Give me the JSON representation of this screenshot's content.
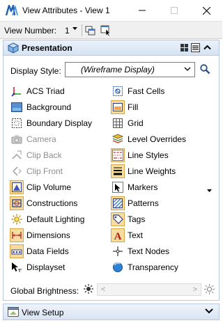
{
  "window": {
    "title": "View Attributes - View 1"
  },
  "toolbar": {
    "view_number_label": "View Number:",
    "view_number_value": "1"
  },
  "panel": {
    "title": "Presentation",
    "display_style_label": "Display Style:",
    "display_style_value": "(Wireframe Display)"
  },
  "attributes": [
    {
      "label": "ACS Triad",
      "icon": "acs-triad-icon",
      "enabled": true,
      "selected": false
    },
    {
      "label": "Background",
      "icon": "background-icon",
      "enabled": true,
      "selected": false
    },
    {
      "label": "Boundary Display",
      "icon": "boundary-display-icon",
      "enabled": true,
      "selected": false
    },
    {
      "label": "Camera",
      "icon": "camera-icon",
      "enabled": false,
      "selected": false
    },
    {
      "label": "Clip Back",
      "icon": "clip-back-icon",
      "enabled": false,
      "selected": false
    },
    {
      "label": "Clip Front",
      "icon": "clip-front-icon",
      "enabled": false,
      "selected": false
    },
    {
      "label": "Clip Volume",
      "icon": "clip-volume-icon",
      "enabled": true,
      "selected": true
    },
    {
      "label": "Constructions",
      "icon": "constructions-icon",
      "enabled": true,
      "selected": true
    },
    {
      "label": "Default Lighting",
      "icon": "default-lighting-icon",
      "enabled": true,
      "selected": false
    },
    {
      "label": "Dimensions",
      "icon": "dimensions-icon",
      "enabled": true,
      "selected": true
    },
    {
      "label": "Data Fields",
      "icon": "data-fields-icon",
      "enabled": true,
      "selected": true
    },
    {
      "label": "Displayset",
      "icon": "displayset-icon",
      "enabled": true,
      "selected": false
    },
    {
      "label": "Fast Cells",
      "icon": "fast-cells-icon",
      "enabled": true,
      "selected": false
    },
    {
      "label": "Fill",
      "icon": "fill-icon",
      "enabled": true,
      "selected": true
    },
    {
      "label": "Grid",
      "icon": "grid-icon",
      "enabled": true,
      "selected": false
    },
    {
      "label": "Level Overrides",
      "icon": "level-overrides-icon",
      "enabled": true,
      "selected": false
    },
    {
      "label": "Line Styles",
      "icon": "line-styles-icon",
      "enabled": true,
      "selected": true
    },
    {
      "label": "Line Weights",
      "icon": "line-weights-icon",
      "enabled": true,
      "selected": true
    },
    {
      "label": "Markers",
      "icon": "markers-icon",
      "enabled": true,
      "selected": false
    },
    {
      "label": "Patterns",
      "icon": "patterns-icon",
      "enabled": true,
      "selected": true
    },
    {
      "label": "Tags",
      "icon": "tags-icon",
      "enabled": true,
      "selected": true
    },
    {
      "label": "Text",
      "icon": "text-icon",
      "enabled": true,
      "selected": true
    },
    {
      "label": "Text Nodes",
      "icon": "text-nodes-icon",
      "enabled": true,
      "selected": false
    },
    {
      "label": "Transparency",
      "icon": "transparency-icon",
      "enabled": true,
      "selected": false
    }
  ],
  "brightness": {
    "label": "Global Brightness:",
    "dec_arrow": "<",
    "inc_arrow": ">"
  },
  "footer": {
    "view_setup_label": "View Setup"
  },
  "colors": {
    "accent": "#3c78c8",
    "selected_bg": "#f7dca0",
    "panel_header": "#d6e3f3"
  }
}
